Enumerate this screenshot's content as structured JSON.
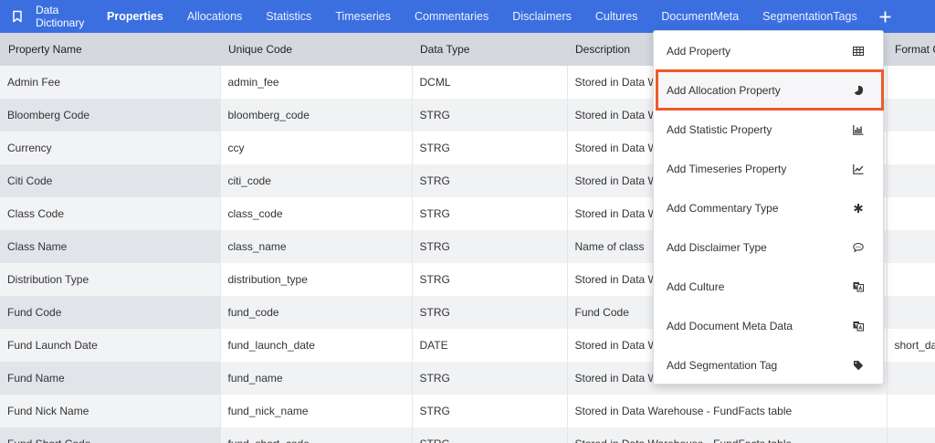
{
  "nav": {
    "brand": "Data Dictionary",
    "links": [
      "Properties",
      "Allocations",
      "Statistics",
      "Timeseries",
      "Commentaries",
      "Disclaimers",
      "Cultures",
      "DocumentMeta",
      "SegmentationTags"
    ],
    "active_index": 0
  },
  "table": {
    "headers": [
      "Property Name",
      "Unique Code",
      "Data Type",
      "Description",
      "",
      "Format C"
    ],
    "rows": [
      [
        "Admin Fee",
        "admin_fee",
        "DCML",
        "Stored in Data W",
        ""
      ],
      [
        "Bloomberg Code",
        "bloomberg_code",
        "STRG",
        "Stored in Data W",
        ""
      ],
      [
        "Currency",
        "ccy",
        "STRG",
        "Stored in Data W",
        ""
      ],
      [
        "Citi Code",
        "citi_code",
        "STRG",
        "Stored in Data W",
        ""
      ],
      [
        "Class Code",
        "class_code",
        "STRG",
        "Stored in Data W",
        ""
      ],
      [
        "Class Name",
        "class_name",
        "STRG",
        "Name of class",
        ""
      ],
      [
        "Distribution Type",
        "distribution_type",
        "STRG",
        "Stored in Data W",
        ""
      ],
      [
        "Fund Code",
        "fund_code",
        "STRG",
        "Fund Code",
        ""
      ],
      [
        "Fund Launch Date",
        "fund_launch_date",
        "DATE",
        "Stored in Data W",
        "short_da"
      ],
      [
        "Fund Name",
        "fund_name",
        "STRG",
        "Stored in Data W",
        ""
      ],
      [
        "Fund Nick Name",
        "fund_nick_name",
        "STRG",
        "Stored in Data Warehouse - FundFacts table",
        ""
      ],
      [
        "Fund Short Code",
        "fund_short_code",
        "STRG",
        "Stored in Data Warehouse - FundFacts table",
        ""
      ]
    ]
  },
  "menu": {
    "items": [
      {
        "label": "Add Property",
        "icon": "table-icon"
      },
      {
        "label": "Add Allocation Property",
        "icon": "pie-chart-icon"
      },
      {
        "label": "Add Statistic Property",
        "icon": "bar-chart-icon"
      },
      {
        "label": "Add Timeseries Property",
        "icon": "line-chart-icon"
      },
      {
        "label": "Add Commentary Type",
        "icon": "asterisk-icon"
      },
      {
        "label": "Add Disclaimer Type",
        "icon": "comment-icon"
      },
      {
        "label": "Add Culture",
        "icon": "language-icon"
      },
      {
        "label": "Add Document Meta Data",
        "icon": "language-icon"
      },
      {
        "label": "Add Segmentation Tag",
        "icon": "tag-icon"
      }
    ],
    "highlighted_index": 1
  },
  "colors": {
    "nav_bg": "#3b6fe0",
    "highlight_border": "#ee5a2c"
  }
}
